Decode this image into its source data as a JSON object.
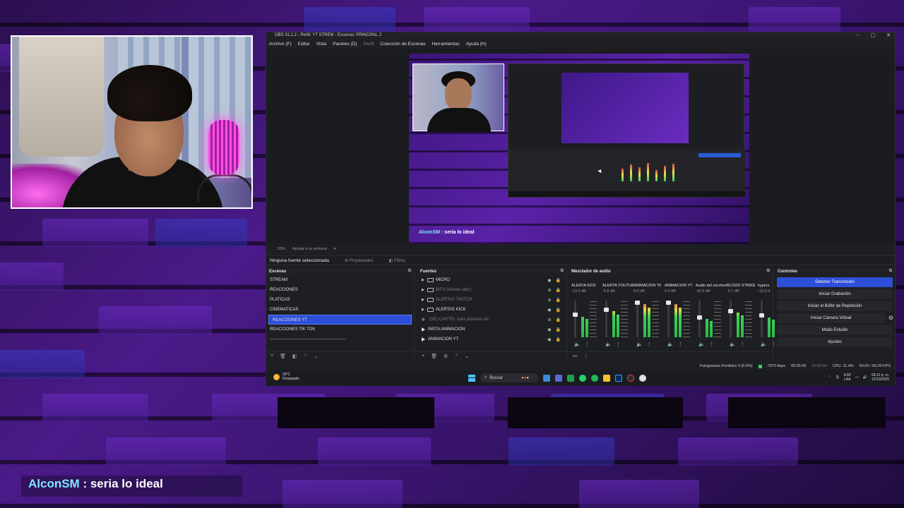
{
  "obs": {
    "title": "OBS 31.1.2 - Perfil: YT STREM - Escenas: PRINCIPAL 2",
    "window_controls": [
      "–",
      "▢",
      "✕"
    ],
    "menu": [
      {
        "label": "Archivo (F)",
        "dim": false
      },
      {
        "label": "Editar",
        "dim": false
      },
      {
        "label": "Vista",
        "dim": false
      },
      {
        "label": "Paneles (D)",
        "dim": false
      },
      {
        "label": "Perfil",
        "dim": true
      },
      {
        "label": "Colección de Escenas",
        "dim": false
      },
      {
        "label": "Herramientas",
        "dim": false
      },
      {
        "label": "Ayuda (H)",
        "dim": false
      }
    ],
    "preview_chat": {
      "user": "AlconSM",
      "message": " : seria lo ideal"
    },
    "zoom": {
      "value": "53%",
      "fit": "Ajustar a la ventana"
    },
    "source_bar": {
      "selected": "Ninguna fuente seleccionada",
      "properties": "Propiedades",
      "filters": "Filtros"
    },
    "scenes": {
      "title": "Escenas",
      "items": [
        "STREAM",
        "REACCIONES",
        "PLATICAS",
        "CINEMATICAS",
        "REACCIONES YT",
        "REACCIONES TIK TOK"
      ],
      "selected_index": 4
    },
    "sources": {
      "title": "Fuentes",
      "items": [
        {
          "label": "MICRO",
          "type": "folder",
          "dim": false
        },
        {
          "label": "BITS (stream labs)",
          "type": "folder",
          "dim": true
        },
        {
          "label": "ALERTAS TWITCH",
          "type": "folder",
          "dim": true
        },
        {
          "label": "ALERTAS KICK",
          "type": "folder",
          "dim": false
        },
        {
          "label": "(SE) CARTEL subs,donador,etc",
          "type": "browser",
          "dim": true
        },
        {
          "label": "INSTA ANIMACION",
          "type": "media",
          "dim": false
        },
        {
          "label": "ANIMACION YT",
          "type": "media",
          "dim": false
        }
      ]
    },
    "mixer": {
      "title": "Mezclador de audio",
      "channels": [
        {
          "name": "ALERTA KICK",
          "db": "-13.5 dB",
          "level": 0.62
        },
        {
          "name": "ALERTA YOUTUBE",
          "db": "-5.8 dB",
          "level": 0.78
        },
        {
          "name": "ANIMACION TK",
          "db": "0.0 dB",
          "level": 1.0
        },
        {
          "name": "ANIMACION YT",
          "db": "0.0 dB",
          "level": 1.0
        },
        {
          "name": "Audio del escritorio",
          "db": "-16.5 dB",
          "level": 0.55
        },
        {
          "name": "BLOOD STRIKE",
          "db": "-6.7 dB",
          "level": 0.75
        },
        {
          "name": "hyperx",
          "db": "-13.0 d",
          "level": 0.6
        }
      ]
    },
    "controls": {
      "title": "Controles",
      "buttons": [
        "Detener Transmisión",
        "Iniciar Grabación",
        "Iniciar el Búfer de Repetición",
        "Iniciar Cámara Virtual",
        "Modo Estudio",
        "Ajustes"
      ]
    },
    "status": {
      "dropped": "Fotogramas Perdidos 0 (0.0%)",
      "bitrate": "7975 kbps",
      "stream_time": "00:26:09",
      "rec_time": "00:00:00",
      "cpu": "CPU: 11.4%",
      "fps": "60.00 / 60.00 FPS"
    },
    "taskbar": {
      "temp": "30°C",
      "weather": "Despejado",
      "search": "Buscar",
      "lang": "ESP",
      "lang2": "LAA",
      "time": "09:12 p. m.",
      "date": "12/10/2025"
    }
  },
  "chat_overlay": {
    "user": "AlconSM",
    "message": " : seria lo ideal"
  },
  "colors": {
    "accent": "#2d4fd8",
    "chat_user": "#7fe7ff",
    "meter_green": "#3cd05a"
  }
}
